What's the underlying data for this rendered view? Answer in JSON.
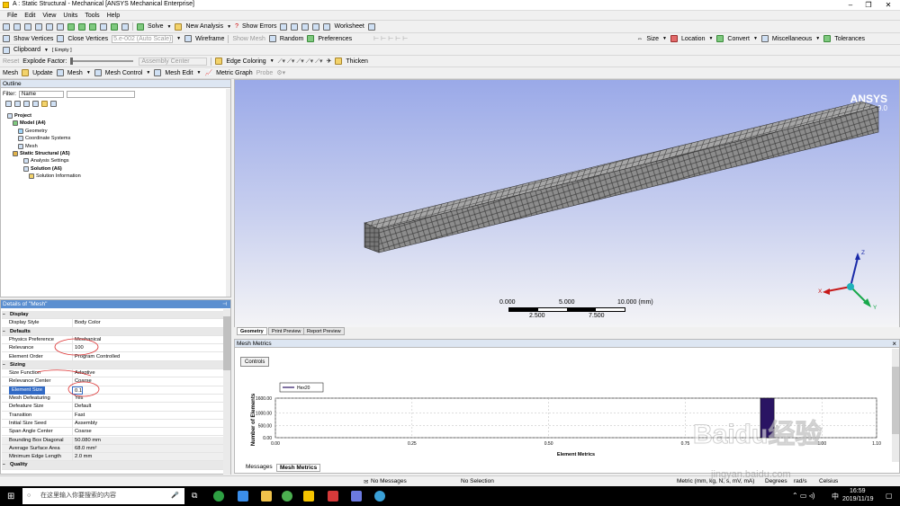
{
  "window": {
    "title": "A : Static Structural - Mechanical [ANSYS Mechanical Enterprise]",
    "minimize": "–",
    "restore": "❐",
    "close": "✕"
  },
  "menu": [
    "File",
    "Edit",
    "View",
    "Units",
    "Tools",
    "Help"
  ],
  "toolbar1": {
    "solve": "Solve",
    "new_analysis": "New Analysis",
    "show_errors": "Show Errors",
    "worksheet": "Worksheet"
  },
  "toolbar2": {
    "show_vertices": "Show Vertices",
    "close_vertices": "Close Vertices",
    "vertex_value": "5.e-002 (Auto Scale)",
    "wireframe": "Wireframe",
    "show_mesh": "Show Mesh",
    "random": "Random",
    "preferences": "Preferences",
    "size": "Size",
    "location": "Location",
    "convert": "Convert",
    "miscellaneous": "Miscellaneous",
    "tolerances": "Tolerances"
  },
  "toolbar3": {
    "clipboard": "Clipboard",
    "clipboard_value": "[ Empty ]"
  },
  "toolbar4": {
    "reset": "Reset",
    "explode_factor": "Explode Factor:",
    "assembly_center": "Assembly Center",
    "edge_coloring": "Edge Coloring",
    "thicken": "Thicken"
  },
  "toolbar5": {
    "mesh": "Mesh",
    "update": "Update",
    "mesh_dd": "Mesh",
    "mesh_control": "Mesh Control",
    "mesh_edit": "Mesh Edit",
    "metric_graph": "Metric Graph",
    "probe": "Probe"
  },
  "outline": {
    "title": "Outline",
    "filter_label": "Filter:",
    "filter_value": "Name",
    "tree": [
      {
        "label": "Project",
        "bold": true
      },
      {
        "label": "Model (A4)",
        "bold": true
      },
      {
        "label": "Geometry",
        "bold": false
      },
      {
        "label": "Coordinate Systems",
        "bold": false
      },
      {
        "label": "Mesh",
        "bold": false
      },
      {
        "label": "Static Structural (A5)",
        "bold": true
      },
      {
        "label": "Analysis Settings",
        "bold": false
      },
      {
        "label": "Solution (A6)",
        "bold": true
      },
      {
        "label": "Solution Information",
        "bold": false
      }
    ]
  },
  "details": {
    "title": "Details of \"Mesh\"",
    "rows": [
      {
        "type": "group",
        "key": "Display"
      },
      {
        "type": "row",
        "key": "Display Style",
        "value": "Body Color"
      },
      {
        "type": "group",
        "key": "Defaults"
      },
      {
        "type": "row",
        "key": "Physics Preference",
        "value": "Mechanical"
      },
      {
        "type": "row",
        "key": "Relevance",
        "value": "100"
      },
      {
        "type": "row",
        "key": "Element Order",
        "value": "Program Controlled"
      },
      {
        "type": "group",
        "key": "Sizing"
      },
      {
        "type": "row",
        "key": "Size Function",
        "value": "Adaptive"
      },
      {
        "type": "row",
        "key": "Relevance Center",
        "value": "Coarse"
      },
      {
        "type": "sel",
        "key": "Element Size",
        "value": "0.1"
      },
      {
        "type": "row",
        "key": "Mesh Defeaturing",
        "value": "Yes"
      },
      {
        "type": "row",
        "key": "Defeature Size",
        "value": "Default"
      },
      {
        "type": "row",
        "key": "Transition",
        "value": "Fast"
      },
      {
        "type": "row",
        "key": "Initial Size Seed",
        "value": "Assembly"
      },
      {
        "type": "row",
        "key": "Span Angle Center",
        "value": "Coarse"
      },
      {
        "type": "shade",
        "key": "Bounding Box Diagonal",
        "value": "50.080 mm"
      },
      {
        "type": "shade",
        "key": "Average Surface Area",
        "value": "68.0 mm²"
      },
      {
        "type": "shade",
        "key": "Minimum Edge Length",
        "value": "2.0 mm"
      },
      {
        "type": "group",
        "key": "Quality"
      }
    ]
  },
  "viewport": {
    "logo": "ANSYS",
    "version": "R19.0",
    "scale_top": [
      "0.000",
      "5.000",
      "10.000 (mm)"
    ],
    "scale_bottom": [
      "2.500",
      "7.500"
    ],
    "axis_x": "X",
    "axis_y": "Y",
    "axis_z": "Z"
  },
  "view_tabs": [
    "Geometry",
    "Print Preview",
    "Report Preview"
  ],
  "metrics": {
    "title": "Mesh Metrics",
    "controls_button": "Controls",
    "legend": "Hex20",
    "ylabel": "Number of Elements",
    "xlabel": "Element Metrics",
    "close": "×"
  },
  "chart_data": {
    "type": "bar",
    "title": "",
    "xlabel": "Element Metrics",
    "ylabel": "Number of Elements",
    "series": [
      {
        "name": "Hex20",
        "x": [
          0.9
        ],
        "values": [
          1600
        ],
        "color": "#2a1463"
      }
    ],
    "x_ticks": [
      "0.00",
      "0.25",
      "0.50",
      "0.75",
      "1.00",
      "1.10"
    ],
    "x_tick_values": [
      0,
      0.25,
      0.5,
      0.75,
      1.0,
      1.1
    ],
    "y_ticks": [
      "1600.00",
      "1000.00",
      "500.00",
      "0.00"
    ],
    "y_tick_values": [
      1600,
      1000,
      500,
      0
    ],
    "xlim": [
      0,
      1.1
    ],
    "ylim": [
      0,
      1600
    ],
    "bar_width": 0.025,
    "grid": true
  },
  "bottom_tabs": [
    "Messages",
    "Mesh Metrics"
  ],
  "status": {
    "messages": "No Messages",
    "selection": "No Selection",
    "units": "Metric (mm, kg, N, s, mV, mA)",
    "degrees": "Degrees",
    "rads": "rad/s",
    "temp": "Celsius"
  },
  "taskbar": {
    "search": "在这里输入你要搜索的内容",
    "ime": "中",
    "time": "16:59",
    "date": "2019/11/19"
  },
  "watermark": {
    "brand": "Baidu经验",
    "url": "jingyan.baidu.com"
  }
}
